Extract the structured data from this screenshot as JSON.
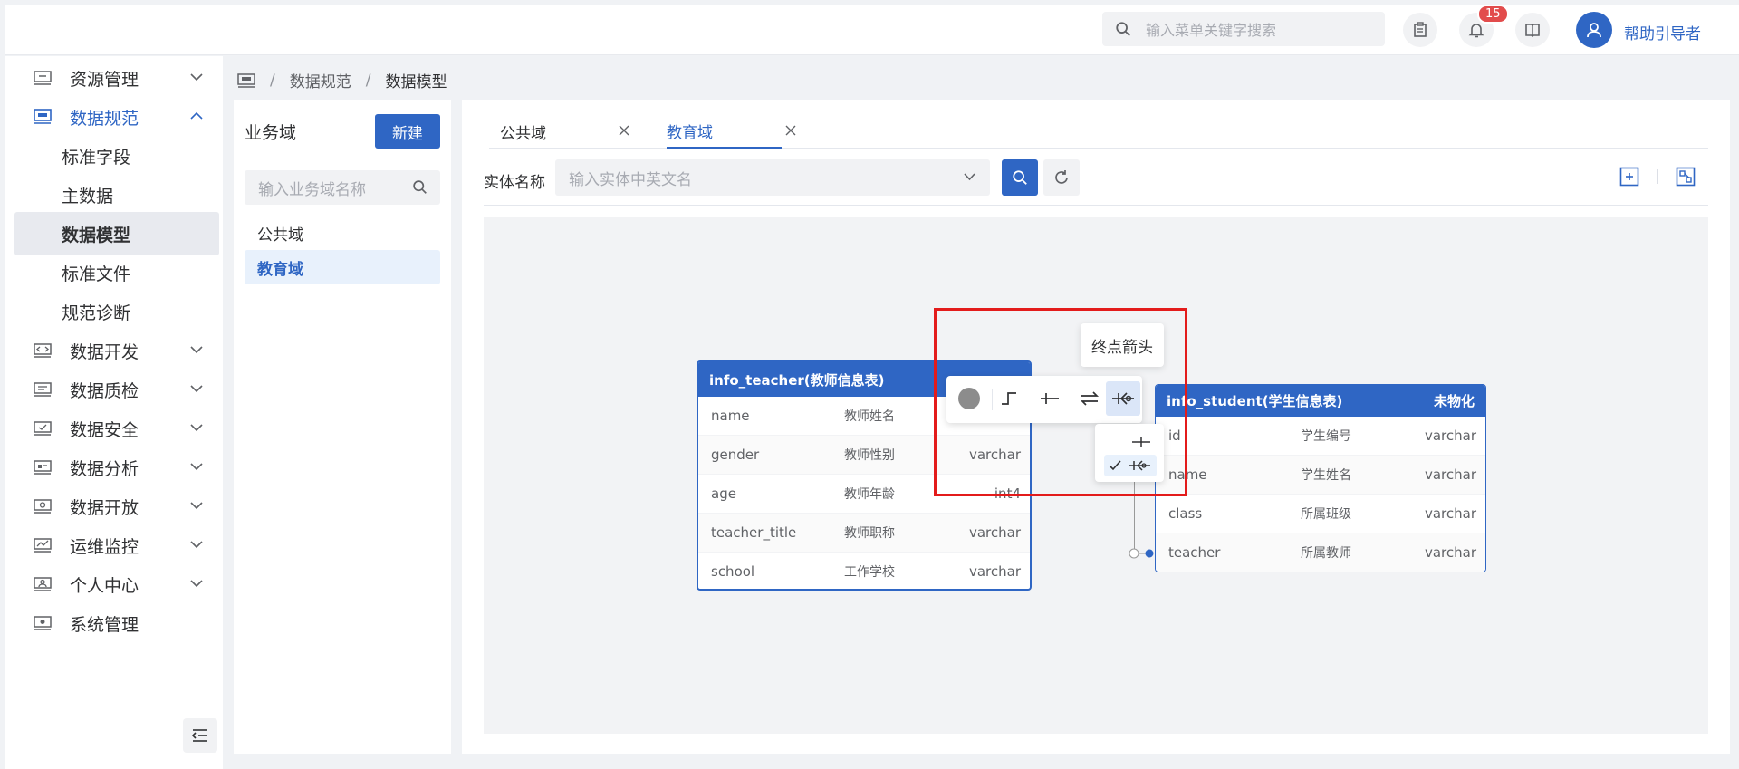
{
  "header": {
    "search_placeholder": "输入菜单关键字搜索",
    "notification_count": "15",
    "user_name": "帮助引导者"
  },
  "sidebar": {
    "items": [
      {
        "label": "资源管理",
        "icon": "server-icon"
      },
      {
        "label": "数据规范",
        "icon": "monitor-icon"
      },
      {
        "label": "数据开发",
        "icon": "code-icon"
      },
      {
        "label": "数据质检",
        "icon": "document-icon"
      },
      {
        "label": "数据安全",
        "icon": "shield-icon"
      },
      {
        "label": "数据分析",
        "icon": "chart-icon"
      },
      {
        "label": "数据开放",
        "icon": "open-icon"
      },
      {
        "label": "运维监控",
        "icon": "monitor-line-icon"
      },
      {
        "label": "个人中心",
        "icon": "user-icon"
      },
      {
        "label": "系统管理",
        "icon": "settings-icon"
      }
    ],
    "sub_items": [
      "标准字段",
      "主数据",
      "数据模型",
      "标准文件",
      "规范诊断"
    ],
    "active_sub": "数据模型"
  },
  "breadcrumb": {
    "items": [
      "数据规范",
      "数据模型"
    ]
  },
  "domain_panel": {
    "title": "业务域",
    "new_button": "新建",
    "search_placeholder": "输入业务域名称",
    "items": [
      "公共域",
      "教育域"
    ],
    "active": "教育域"
  },
  "tabs": [
    {
      "label": "公共域",
      "active": false
    },
    {
      "label": "教育域",
      "active": true
    }
  ],
  "filter": {
    "label": "实体名称",
    "placeholder": "输入实体中英文名"
  },
  "entities": {
    "teacher": {
      "title": "info_teacher(教师信息表)",
      "rows": [
        {
          "name": "name",
          "comment": "教师姓名",
          "type": ""
        },
        {
          "name": "gender",
          "comment": "教师性别",
          "type": "varchar"
        },
        {
          "name": "age",
          "comment": "教师年龄",
          "type": "int4"
        },
        {
          "name": "teacher_title",
          "comment": "教师职称",
          "type": "varchar"
        },
        {
          "name": "school",
          "comment": "工作学校",
          "type": "varchar"
        }
      ]
    },
    "student": {
      "title": "info_student(学生信息表)",
      "status": "未物化",
      "rows": [
        {
          "name": "id",
          "comment": "学生编号",
          "type": "varchar"
        },
        {
          "name": "name",
          "comment": "学生姓名",
          "type": "varchar"
        },
        {
          "name": "class",
          "comment": "所属班级",
          "type": "varchar"
        },
        {
          "name": "teacher",
          "comment": "所属教师",
          "type": "varchar"
        }
      ]
    }
  },
  "edge_toolbar": {
    "tooltip": "终点箭头"
  },
  "colors": {
    "primary": "#2f66c4",
    "highlight": "#e31b1b",
    "badge": "#e24c4c"
  }
}
